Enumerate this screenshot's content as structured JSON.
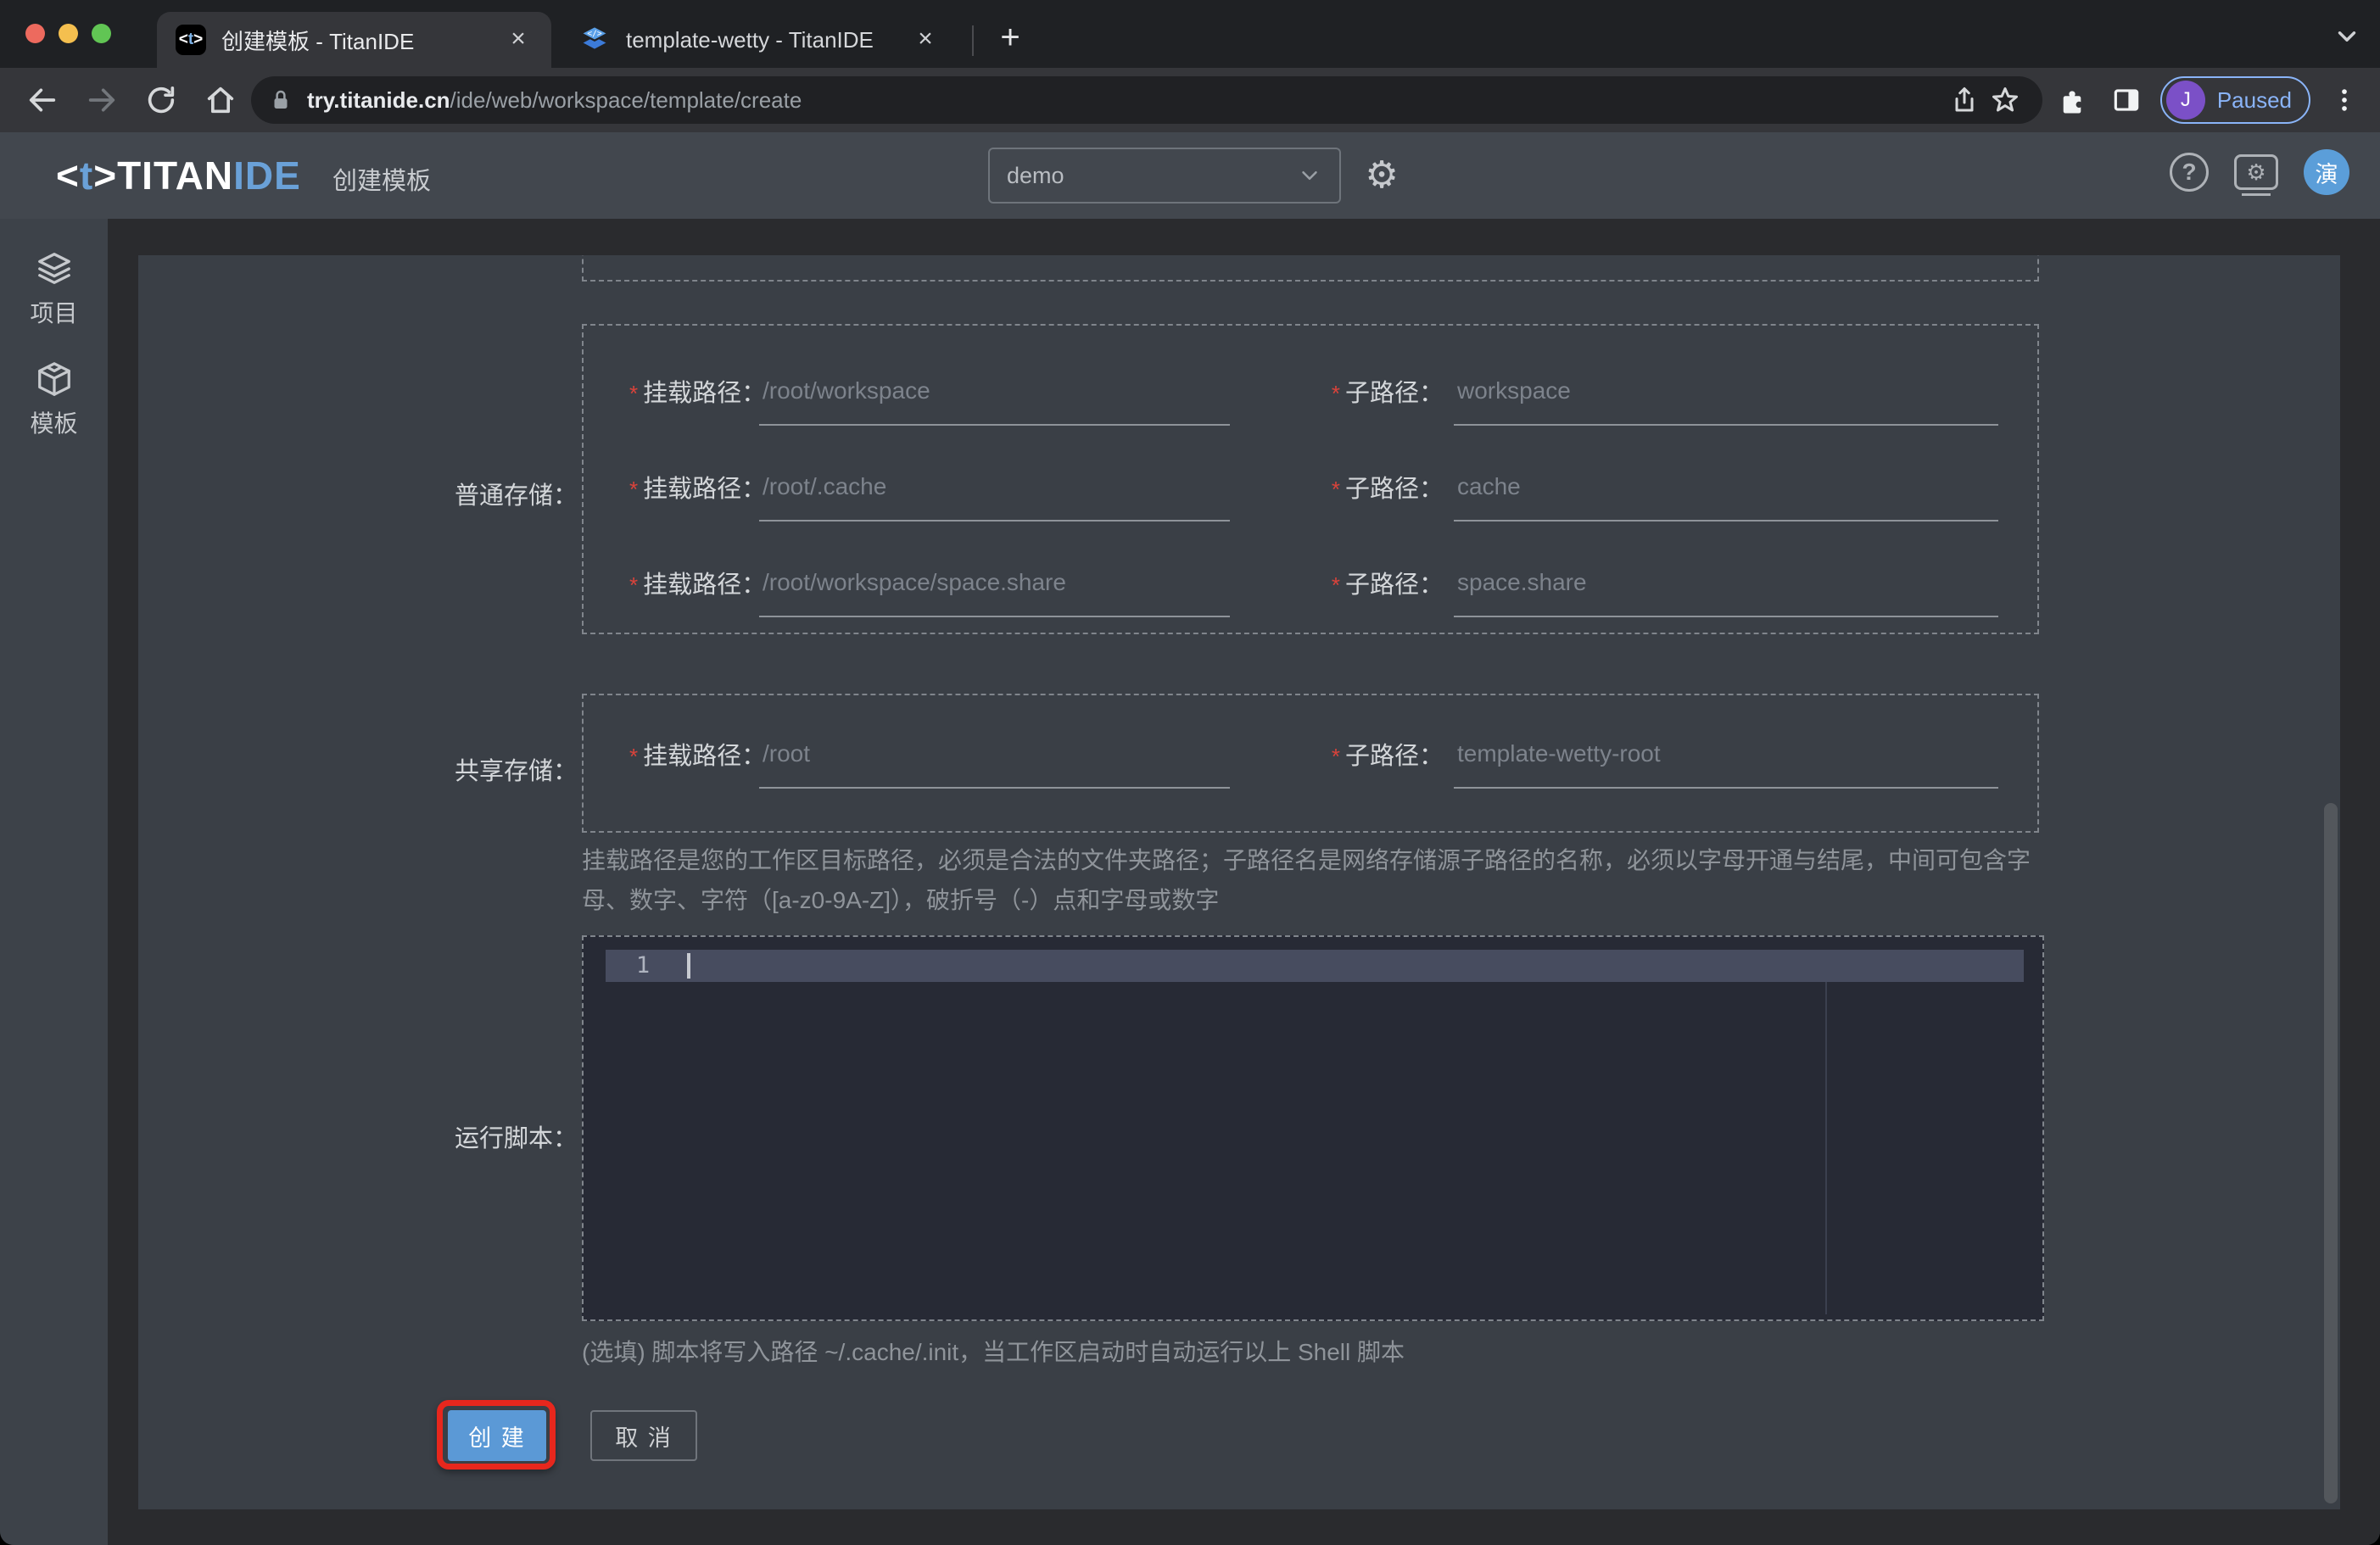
{
  "browser": {
    "tabs": [
      {
        "title": "创建模板 - TitanIDE",
        "favicon_mark_pre": "<",
        "favicon_mark_t": "t",
        "favicon_mark_post": ">",
        "close": "×"
      },
      {
        "title": "template-wetty - TitanIDE",
        "close": "×"
      }
    ],
    "newtab_label": "+",
    "url": {
      "host": "try.titanide.cn",
      "path": "/ide/web/workspace/template/create"
    },
    "profile": {
      "initial": "J",
      "label": "Paused"
    }
  },
  "header": {
    "logo": {
      "mark_open": "<",
      "mark_letter": "t",
      "mark_close": ">",
      "name_primary": "TITAN",
      "name_accent": "IDE"
    },
    "page_title": "创建模板",
    "workspace_select": {
      "value": "demo"
    },
    "gear": "⚙",
    "help_mark": "?",
    "monitor_gear": "⚙",
    "avatar_text": "演"
  },
  "sidebar": {
    "items": [
      {
        "label": "项目",
        "icon": "layers-icon"
      },
      {
        "label": "模板",
        "icon": "cube-icon"
      }
    ]
  },
  "form": {
    "required_mark": "*",
    "normal_storage": {
      "label": "普通存储：",
      "rows": [
        {
          "mount_label": "挂载路径：",
          "mount_placeholder": "/root/workspace",
          "sub_label": "子路径：",
          "sub_placeholder": "workspace"
        },
        {
          "mount_label": "挂载路径：",
          "mount_placeholder": "/root/.cache",
          "sub_label": "子路径：",
          "sub_placeholder": "cache"
        },
        {
          "mount_label": "挂载路径：",
          "mount_placeholder": "/root/workspace/space.share",
          "sub_label": "子路径：",
          "sub_placeholder": "space.share"
        }
      ]
    },
    "shared_storage": {
      "label": "共享存储：",
      "rows": [
        {
          "mount_label": "挂载路径：",
          "mount_placeholder": "/root",
          "sub_label": "子路径：",
          "sub_placeholder": "template-wetty-root"
        }
      ]
    },
    "hint": "挂载路径是您的工作区目标路径，必须是合法的文件夹路径；子路径名是网络存储源子路径的名称，必须以字母开通与结尾，中间可包含字母、数字、字符（[a-z0-9A-Z]），破折号（-）点和字母或数字",
    "script": {
      "label": "运行脚本：",
      "line_number": "1",
      "note": "(选填) 脚本将写入路径 ~/.cache/.init，当工作区启动时自动运行以上 Shell 脚本"
    },
    "actions": {
      "create": "创 建",
      "cancel": "取 消"
    }
  },
  "colors": {
    "accent_blue": "#5b99d6",
    "annotation_red": "#e7271d",
    "avatar_blue": "#5b9ed9",
    "profile_purple": "#7b50c7",
    "paused_blue": "#8ab4f8",
    "editor_bg": "#272a35",
    "current_line": "#474c5f"
  }
}
